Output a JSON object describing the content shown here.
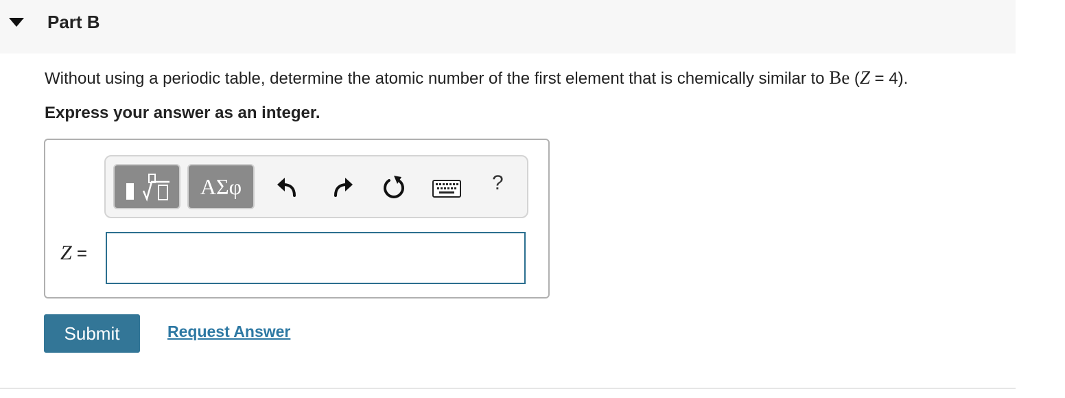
{
  "part": {
    "title": "Part B"
  },
  "question": {
    "text_before": "Without using a periodic table, determine the atomic number of the first element that is chemically similar to ",
    "element_symbol": "Be",
    "paren_open": " (",
    "variable": "Z",
    "equals_value": " = 4).",
    "instruction": "Express your answer as an integer."
  },
  "toolbar": {
    "greek_label": "ΑΣφ",
    "help_label": "?",
    "icons": [
      "templates-icon",
      "greek-letters",
      "undo-icon",
      "redo-icon",
      "reset-icon",
      "keyboard-icon",
      "help-icon"
    ]
  },
  "answer": {
    "variable": "Z",
    "equals": " =",
    "value": "",
    "placeholder": ""
  },
  "actions": {
    "submit_label": "Submit",
    "request_answer_label": "Request Answer"
  },
  "colors": {
    "header_bg": "#f7f7f7",
    "submit_bg": "#337697",
    "link": "#2d78a3",
    "input_border": "#2b6f8f",
    "tool_button_bg": "#8a8a8a"
  }
}
